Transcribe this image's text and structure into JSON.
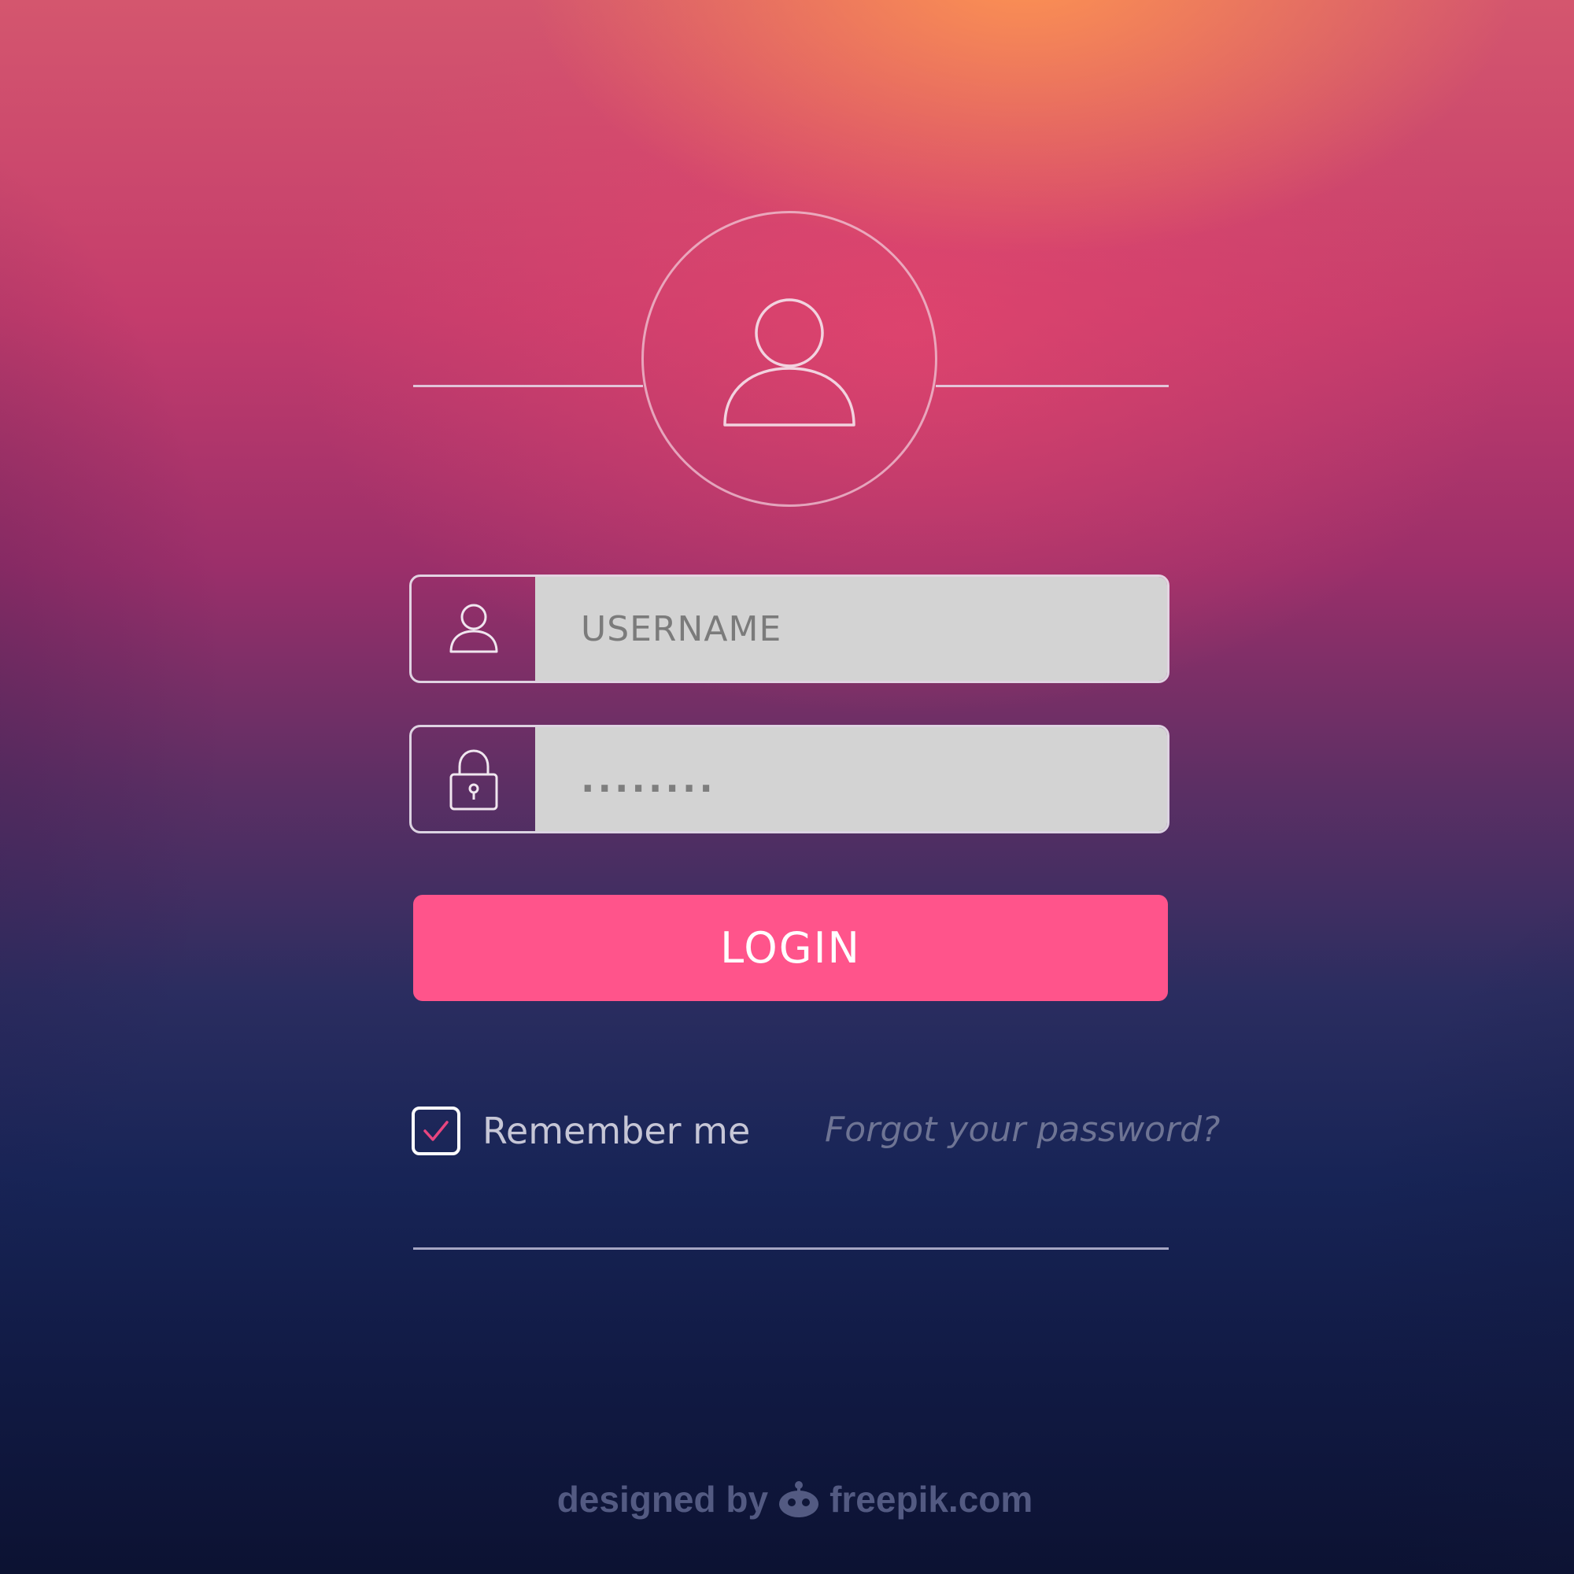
{
  "avatar": {
    "icon": "user-icon"
  },
  "form": {
    "username": {
      "placeholder": "USERNAME",
      "icon": "user-icon"
    },
    "password": {
      "value": "........",
      "icon": "lock-icon"
    },
    "login_label": "LOGIN",
    "remember_label": "Remember me",
    "remember_checked": true,
    "forgot_label": "Forgot your password?"
  },
  "footer": {
    "credit_prefix": "designed by",
    "credit_brand": "freepik.com"
  },
  "colors": {
    "accent": "#ff548b",
    "input_bg": "#d3d3d3",
    "check_mark": "#e8457f"
  }
}
